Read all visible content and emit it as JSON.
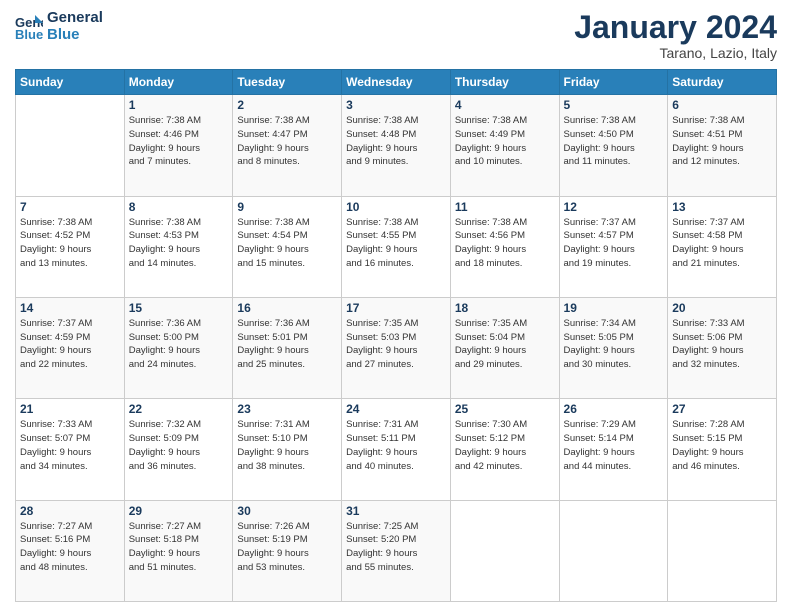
{
  "logo": {
    "line1": "General",
    "line2": "Blue"
  },
  "title": "January 2024",
  "subtitle": "Tarano, Lazio, Italy",
  "header_days": [
    "Sunday",
    "Monday",
    "Tuesday",
    "Wednesday",
    "Thursday",
    "Friday",
    "Saturday"
  ],
  "weeks": [
    [
      {
        "day": "",
        "info": ""
      },
      {
        "day": "1",
        "info": "Sunrise: 7:38 AM\nSunset: 4:46 PM\nDaylight: 9 hours\nand 7 minutes."
      },
      {
        "day": "2",
        "info": "Sunrise: 7:38 AM\nSunset: 4:47 PM\nDaylight: 9 hours\nand 8 minutes."
      },
      {
        "day": "3",
        "info": "Sunrise: 7:38 AM\nSunset: 4:48 PM\nDaylight: 9 hours\nand 9 minutes."
      },
      {
        "day": "4",
        "info": "Sunrise: 7:38 AM\nSunset: 4:49 PM\nDaylight: 9 hours\nand 10 minutes."
      },
      {
        "day": "5",
        "info": "Sunrise: 7:38 AM\nSunset: 4:50 PM\nDaylight: 9 hours\nand 11 minutes."
      },
      {
        "day": "6",
        "info": "Sunrise: 7:38 AM\nSunset: 4:51 PM\nDaylight: 9 hours\nand 12 minutes."
      }
    ],
    [
      {
        "day": "7",
        "info": "Sunrise: 7:38 AM\nSunset: 4:52 PM\nDaylight: 9 hours\nand 13 minutes."
      },
      {
        "day": "8",
        "info": "Sunrise: 7:38 AM\nSunset: 4:53 PM\nDaylight: 9 hours\nand 14 minutes."
      },
      {
        "day": "9",
        "info": "Sunrise: 7:38 AM\nSunset: 4:54 PM\nDaylight: 9 hours\nand 15 minutes."
      },
      {
        "day": "10",
        "info": "Sunrise: 7:38 AM\nSunset: 4:55 PM\nDaylight: 9 hours\nand 16 minutes."
      },
      {
        "day": "11",
        "info": "Sunrise: 7:38 AM\nSunset: 4:56 PM\nDaylight: 9 hours\nand 18 minutes."
      },
      {
        "day": "12",
        "info": "Sunrise: 7:37 AM\nSunset: 4:57 PM\nDaylight: 9 hours\nand 19 minutes."
      },
      {
        "day": "13",
        "info": "Sunrise: 7:37 AM\nSunset: 4:58 PM\nDaylight: 9 hours\nand 21 minutes."
      }
    ],
    [
      {
        "day": "14",
        "info": "Sunrise: 7:37 AM\nSunset: 4:59 PM\nDaylight: 9 hours\nand 22 minutes."
      },
      {
        "day": "15",
        "info": "Sunrise: 7:36 AM\nSunset: 5:00 PM\nDaylight: 9 hours\nand 24 minutes."
      },
      {
        "day": "16",
        "info": "Sunrise: 7:36 AM\nSunset: 5:01 PM\nDaylight: 9 hours\nand 25 minutes."
      },
      {
        "day": "17",
        "info": "Sunrise: 7:35 AM\nSunset: 5:03 PM\nDaylight: 9 hours\nand 27 minutes."
      },
      {
        "day": "18",
        "info": "Sunrise: 7:35 AM\nSunset: 5:04 PM\nDaylight: 9 hours\nand 29 minutes."
      },
      {
        "day": "19",
        "info": "Sunrise: 7:34 AM\nSunset: 5:05 PM\nDaylight: 9 hours\nand 30 minutes."
      },
      {
        "day": "20",
        "info": "Sunrise: 7:33 AM\nSunset: 5:06 PM\nDaylight: 9 hours\nand 32 minutes."
      }
    ],
    [
      {
        "day": "21",
        "info": "Sunrise: 7:33 AM\nSunset: 5:07 PM\nDaylight: 9 hours\nand 34 minutes."
      },
      {
        "day": "22",
        "info": "Sunrise: 7:32 AM\nSunset: 5:09 PM\nDaylight: 9 hours\nand 36 minutes."
      },
      {
        "day": "23",
        "info": "Sunrise: 7:31 AM\nSunset: 5:10 PM\nDaylight: 9 hours\nand 38 minutes."
      },
      {
        "day": "24",
        "info": "Sunrise: 7:31 AM\nSunset: 5:11 PM\nDaylight: 9 hours\nand 40 minutes."
      },
      {
        "day": "25",
        "info": "Sunrise: 7:30 AM\nSunset: 5:12 PM\nDaylight: 9 hours\nand 42 minutes."
      },
      {
        "day": "26",
        "info": "Sunrise: 7:29 AM\nSunset: 5:14 PM\nDaylight: 9 hours\nand 44 minutes."
      },
      {
        "day": "27",
        "info": "Sunrise: 7:28 AM\nSunset: 5:15 PM\nDaylight: 9 hours\nand 46 minutes."
      }
    ],
    [
      {
        "day": "28",
        "info": "Sunrise: 7:27 AM\nSunset: 5:16 PM\nDaylight: 9 hours\nand 48 minutes."
      },
      {
        "day": "29",
        "info": "Sunrise: 7:27 AM\nSunset: 5:18 PM\nDaylight: 9 hours\nand 51 minutes."
      },
      {
        "day": "30",
        "info": "Sunrise: 7:26 AM\nSunset: 5:19 PM\nDaylight: 9 hours\nand 53 minutes."
      },
      {
        "day": "31",
        "info": "Sunrise: 7:25 AM\nSunset: 5:20 PM\nDaylight: 9 hours\nand 55 minutes."
      },
      {
        "day": "",
        "info": ""
      },
      {
        "day": "",
        "info": ""
      },
      {
        "day": "",
        "info": ""
      }
    ]
  ]
}
